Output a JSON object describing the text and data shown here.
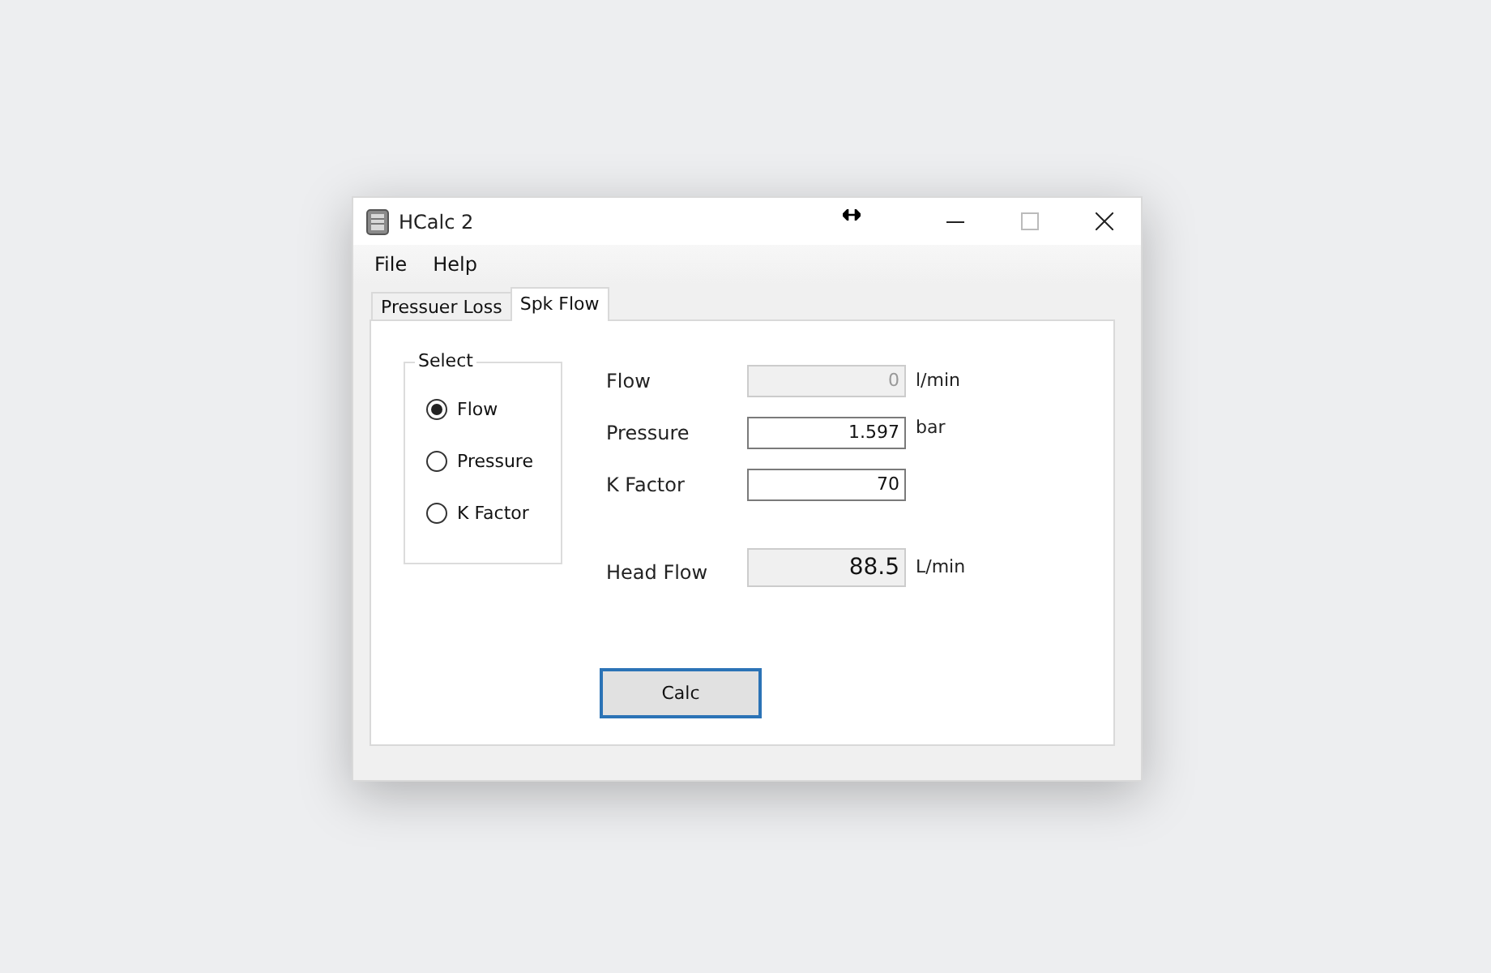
{
  "window": {
    "title": "HCalc 2"
  },
  "menu": [
    "File",
    "Help"
  ],
  "tabs": [
    {
      "label": "Pressuer Loss",
      "selected": false
    },
    {
      "label": "Spk Flow",
      "selected": true
    }
  ],
  "select_group": {
    "title": "Select",
    "options": [
      {
        "label": "Flow",
        "selected": true
      },
      {
        "label": "Pressure",
        "selected": false
      },
      {
        "label": "K Factor",
        "selected": false
      }
    ]
  },
  "fields": [
    {
      "kind": "input",
      "label": "Flow",
      "value": "0",
      "unit": "l/min",
      "disabled": true
    },
    {
      "kind": "input",
      "label": "Pressure",
      "value": "1.597",
      "unit": "bar",
      "disabled": false
    },
    {
      "kind": "input",
      "label": "K Factor",
      "value": "70",
      "disabled": false
    },
    {
      "kind": "result",
      "label": "Head Flow",
      "value": "88.5",
      "unit": "L/min",
      "disabled": false
    }
  ],
  "button": "Calc"
}
